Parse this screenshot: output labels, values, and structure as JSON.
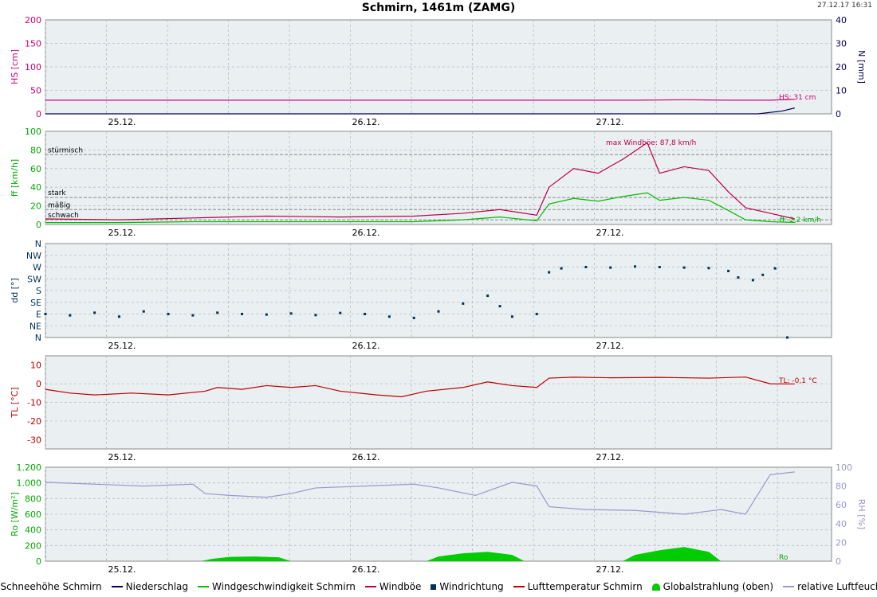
{
  "title": "Schmirn, 1461m (ZAMG)",
  "timestamp": "27.12.17 16:31",
  "legend": [
    {
      "label": "Schneehöhe Schmirn",
      "color": "#cc0077",
      "kind": "line"
    },
    {
      "label": "Niederschlag",
      "color": "#000055",
      "kind": "line"
    },
    {
      "label": "Windgeschwindigkeit Schmirn",
      "color": "#00bb00",
      "kind": "line"
    },
    {
      "label": "Windböe",
      "color": "#bb0044",
      "kind": "line"
    },
    {
      "label": "Windrichtung",
      "color": "#003355",
      "kind": "square"
    },
    {
      "label": "Lufttemperatur Schmirn",
      "color": "#bb0000",
      "kind": "line"
    },
    {
      "label": "Globalstrahlung (oben)",
      "color": "#00cc00",
      "kind": "area"
    },
    {
      "label": "relative Luftfeuchte",
      "color": "#9999cc",
      "kind": "line"
    }
  ],
  "chart_data": [
    {
      "type": "line",
      "title": "",
      "xlabel": "",
      "ylabel": "HS [cm]",
      "ylabel_right": "N [mm]",
      "x_ticks": [
        "25.12.",
        "26.12.",
        "27.12."
      ],
      "ylim": [
        0,
        200
      ],
      "ylim_right": [
        0,
        40
      ],
      "y_ticks": [
        "0",
        "50",
        "100",
        "150",
        "200"
      ],
      "y_ticks_right": [
        "0",
        "10",
        "20",
        "30",
        "40"
      ],
      "annotation": "HS: 31 cm",
      "series": [
        {
          "name": "Schneehöhe Schmirn",
          "x": [
            0,
            2.4,
            2.6,
            2.8,
            2.95,
            3.05
          ],
          "values": [
            29,
            29,
            30,
            29,
            29,
            31
          ]
        },
        {
          "name": "Niederschlag",
          "axis": "right",
          "x": [
            0,
            2.9,
            3.0,
            3.05
          ],
          "values": [
            0,
            0,
            1.2,
            2.5
          ]
        }
      ]
    },
    {
      "type": "line",
      "title": "",
      "xlabel": "",
      "ylabel": "ff [km/h]",
      "x_ticks": [
        "25.12.",
        "26.12.",
        "27.12."
      ],
      "ylim": [
        0,
        100
      ],
      "y_ticks": [
        "0",
        "20",
        "40",
        "60",
        "80",
        "100"
      ],
      "reference_lines": [
        {
          "label": "stürmisch",
          "value": 75
        },
        {
          "label": "stark",
          "value": 29
        },
        {
          "label": "mäßig",
          "value": 16
        },
        {
          "label": "schwach",
          "value": 5
        }
      ],
      "annotations": [
        "max Windböe: 87,8 km/h",
        "ff: 2,2 km/h"
      ],
      "series": [
        {
          "name": "Windböe",
          "x": [
            0,
            0.3,
            0.6,
            0.9,
            1.2,
            1.5,
            1.7,
            1.85,
            2.0,
            2.05,
            2.15,
            2.25,
            2.35,
            2.45,
            2.5,
            2.6,
            2.7,
            2.78,
            2.85,
            2.95,
            3.05
          ],
          "values": [
            6,
            5,
            7,
            9,
            8,
            9,
            12,
            16,
            10,
            40,
            60,
            55,
            70,
            87.8,
            55,
            62,
            58,
            35,
            18,
            12,
            6
          ]
        },
        {
          "name": "Windgeschwindigkeit Schmirn",
          "x": [
            0,
            0.3,
            0.6,
            0.9,
            1.2,
            1.5,
            1.7,
            1.85,
            2.0,
            2.05,
            2.15,
            2.25,
            2.35,
            2.45,
            2.5,
            2.6,
            2.7,
            2.78,
            2.85,
            2.95,
            3.05
          ],
          "values": [
            2,
            2,
            3,
            3,
            3,
            3,
            5,
            8,
            4,
            22,
            28,
            25,
            30,
            34,
            26,
            29,
            26,
            15,
            5,
            3,
            2.2
          ]
        }
      ]
    },
    {
      "type": "scatter",
      "title": "",
      "xlabel": "",
      "ylabel": "dd [°]",
      "x_ticks": [
        "25.12.",
        "26.12.",
        "27.12."
      ],
      "categories": [
        "N",
        "NE",
        "E",
        "SE",
        "S",
        "SW",
        "W",
        "NW",
        "N"
      ],
      "series": [
        {
          "name": "Windrichtung",
          "x": [
            0.0,
            0.1,
            0.2,
            0.3,
            0.4,
            0.5,
            0.6,
            0.7,
            0.8,
            0.9,
            1.0,
            1.1,
            1.2,
            1.3,
            1.4,
            1.5,
            1.6,
            1.7,
            1.8,
            1.85,
            1.9,
            2.0,
            2.05,
            2.1,
            2.2,
            2.3,
            2.4,
            2.5,
            2.6,
            2.7,
            2.78,
            2.82,
            2.88,
            2.92,
            2.97,
            3.02
          ],
          "values": [
            90,
            85,
            95,
            80,
            100,
            90,
            85,
            95,
            90,
            88,
            92,
            86,
            94,
            90,
            80,
            75,
            100,
            130,
            160,
            120,
            80,
            90,
            250,
            265,
            270,
            268,
            272,
            270,
            268,
            266,
            255,
            230,
            220,
            240,
            265,
            0
          ]
        }
      ]
    },
    {
      "type": "line",
      "title": "",
      "xlabel": "",
      "ylabel": "TL [°C]",
      "x_ticks": [
        "25.12.",
        "26.12.",
        "27.12."
      ],
      "ylim": [
        -35,
        15
      ],
      "y_ticks": [
        "-30",
        "-20",
        "-10",
        "0",
        "10"
      ],
      "annotation": "TL: -0,1 °C",
      "series": [
        {
          "name": "Lufttemperatur Schmirn",
          "x": [
            0,
            0.1,
            0.2,
            0.35,
            0.5,
            0.65,
            0.7,
            0.8,
            0.9,
            1.0,
            1.1,
            1.2,
            1.35,
            1.45,
            1.55,
            1.7,
            1.8,
            1.9,
            2.0,
            2.05,
            2.15,
            2.3,
            2.5,
            2.7,
            2.85,
            2.95,
            3.05
          ],
          "values": [
            -3,
            -5,
            -6,
            -5,
            -6,
            -4,
            -2,
            -3,
            -1,
            -2,
            -1,
            -4,
            -6,
            -7,
            -4,
            -2,
            1,
            -1,
            -2,
            3,
            3.5,
            3.2,
            3.4,
            3.0,
            3.6,
            0,
            -0.1
          ]
        }
      ]
    },
    {
      "type": "area",
      "title": "",
      "xlabel": "",
      "ylabel": "Ro [W/m²]",
      "ylabel_right": "RH [%]",
      "x_ticks": [
        "25.12.",
        "26.12.",
        "27.12."
      ],
      "ylim": [
        0,
        1200
      ],
      "ylim_right": [
        0,
        100
      ],
      "y_ticks": [
        "0",
        "200",
        "400",
        "600",
        "800",
        "1.000",
        "1.200"
      ],
      "y_ticks_right": [
        "0",
        "20",
        "40",
        "60",
        "80",
        "100"
      ],
      "annotation": "Ro",
      "series": [
        {
          "name": "Globalstrahlung (oben)",
          "x": [
            0,
            0.63,
            0.68,
            0.75,
            0.85,
            0.95,
            1.0,
            1.55,
            1.6,
            1.7,
            1.8,
            1.9,
            1.95,
            2.35,
            2.4,
            2.5,
            2.6,
            2.7,
            2.75,
            3.1
          ],
          "values": [
            0,
            0,
            30,
            55,
            60,
            50,
            0,
            0,
            60,
            100,
            120,
            80,
            0,
            0,
            80,
            140,
            180,
            120,
            0,
            0
          ]
        },
        {
          "name": "relative Luftfeuchte",
          "axis": "right",
          "x": [
            0,
            0.2,
            0.4,
            0.6,
            0.65,
            0.75,
            0.9,
            1.0,
            1.1,
            1.3,
            1.5,
            1.6,
            1.75,
            1.9,
            2.0,
            2.05,
            2.2,
            2.4,
            2.6,
            2.75,
            2.85,
            2.95,
            3.05
          ],
          "values": [
            84,
            82,
            80,
            82,
            72,
            70,
            68,
            72,
            78,
            80,
            82,
            78,
            70,
            84,
            80,
            58,
            55,
            54,
            50,
            55,
            50,
            92,
            95
          ]
        }
      ]
    }
  ]
}
